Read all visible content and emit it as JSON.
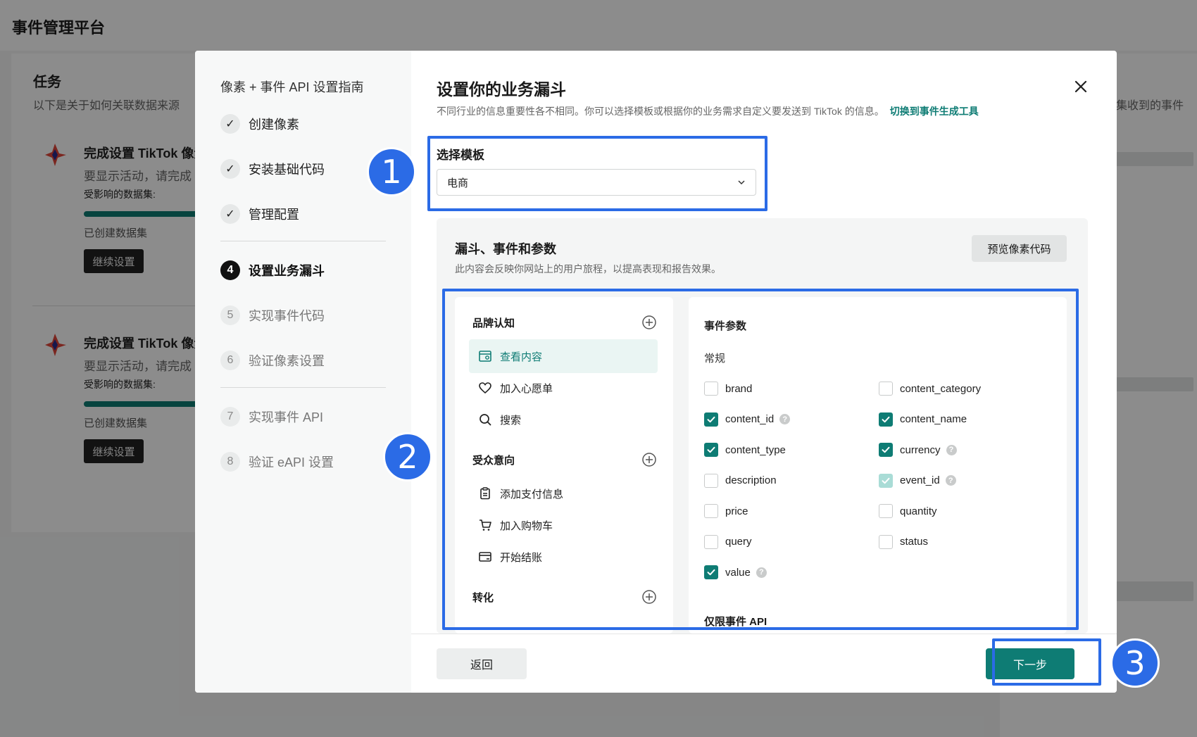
{
  "background": {
    "app_title": "事件管理平台",
    "card_title": "任务",
    "card_desc": "以下是关于如何关联数据来源",
    "right_desc": "集收到的事件",
    "tasks": [
      {
        "title": "完成设置 TikTok 像素",
        "subtitle": "要显示活动，请完成",
        "dataset_label": "受影响的数据集:",
        "created": "已创建数据集",
        "button": "继续设置"
      },
      {
        "title": "完成设置 TikTok 像素",
        "subtitle": "要显示活动，请完成",
        "dataset_label": "受影响的数据集:",
        "created": "已创建数据集",
        "button": "继续设置"
      }
    ]
  },
  "sidebar": {
    "guide_title": "像素 + 事件 API 设置指南",
    "steps": [
      {
        "mark": "✓",
        "label": "创建像素",
        "state": "done"
      },
      {
        "mark": "✓",
        "label": "安装基础代码",
        "state": "done"
      },
      {
        "mark": "✓",
        "label": "管理配置",
        "state": "done"
      },
      {
        "mark": "4",
        "label": "设置业务漏斗",
        "state": "active"
      },
      {
        "mark": "5",
        "label": "实现事件代码",
        "state": "todo"
      },
      {
        "mark": "6",
        "label": "验证像素设置",
        "state": "todo"
      },
      {
        "mark": "7",
        "label": "实现事件 API",
        "state": "todo"
      },
      {
        "mark": "8",
        "label": "验证 eAPI 设置",
        "state": "todo"
      }
    ]
  },
  "modal": {
    "title": "设置你的业务漏斗",
    "description": "不同行业的信息重要性各不相同。你可以选择模板或根据你的业务需求自定义要发送到 TikTok 的信息。",
    "link": "切换到事件生成工具",
    "template_label": "选择模板",
    "template_value": "电商",
    "funnel_title": "漏斗、事件和参数",
    "funnel_desc": "此内容会反映你网站上的用户旅程，以提高表现和报告效果。",
    "preview_button": "预览像素代码",
    "categories": [
      "品牌认知",
      "受众意向",
      "转化"
    ],
    "events": [
      {
        "label": "查看内容",
        "icon": "view-content-icon",
        "selected": true
      },
      {
        "label": "加入心愿单",
        "icon": "heart-icon",
        "selected": false
      },
      {
        "label": "搜索",
        "icon": "search-icon",
        "selected": false
      },
      {
        "label": "添加支付信息",
        "icon": "clipboard-icon",
        "selected": false
      },
      {
        "label": "加入购物车",
        "icon": "cart-icon",
        "selected": false
      },
      {
        "label": "开始结账",
        "icon": "checkout-icon",
        "selected": false
      }
    ],
    "params_title": "事件参数",
    "params_group": "常规",
    "params_group2": "仅限事件 API",
    "params": [
      {
        "name": "brand",
        "state": "off"
      },
      {
        "name": "content_category",
        "state": "off"
      },
      {
        "name": "content_id",
        "state": "on",
        "help": true
      },
      {
        "name": "content_name",
        "state": "on"
      },
      {
        "name": "content_type",
        "state": "on"
      },
      {
        "name": "currency",
        "state": "on",
        "help": true
      },
      {
        "name": "description",
        "state": "off"
      },
      {
        "name": "event_id",
        "state": "dim",
        "help": true
      },
      {
        "name": "price",
        "state": "off"
      },
      {
        "name": "quantity",
        "state": "off"
      },
      {
        "name": "query",
        "state": "off"
      },
      {
        "name": "status",
        "state": "off"
      },
      {
        "name": "value",
        "state": "on",
        "help": true
      }
    ],
    "back_button": "返回",
    "next_button": "下一步",
    "accent_color": "#0e7c74"
  },
  "annotations": {
    "color": "#2b6be6",
    "badges": [
      "1",
      "2",
      "3"
    ]
  }
}
